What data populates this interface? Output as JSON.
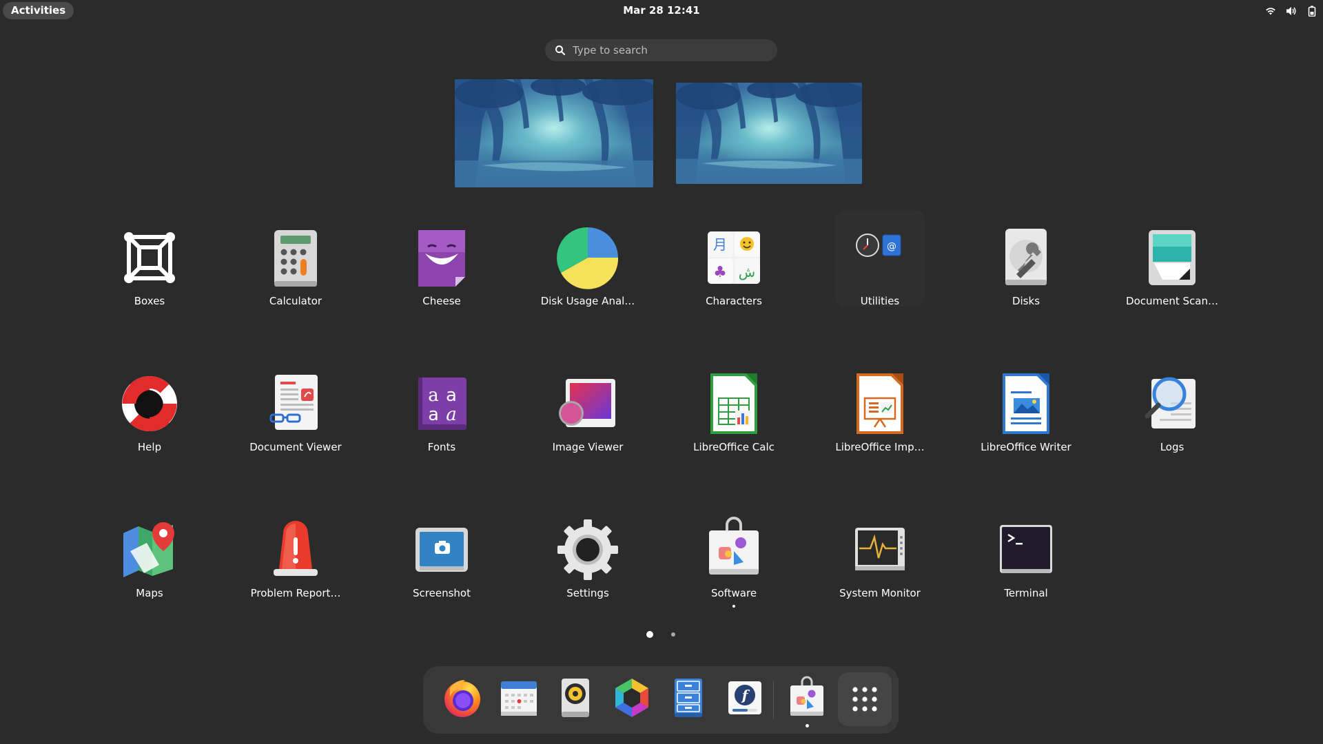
{
  "topbar": {
    "activities_label": "Activities",
    "clock": "Mar 28  12:41",
    "tray_icons": [
      "wifi-icon",
      "volume-icon",
      "battery-icon"
    ]
  },
  "search": {
    "placeholder": "Type to search"
  },
  "workspaces": [
    {
      "name": "workspace-1"
    },
    {
      "name": "workspace-2"
    }
  ],
  "apps": [
    {
      "label": "Boxes"
    },
    {
      "label": "Calculator"
    },
    {
      "label": "Cheese"
    },
    {
      "label": "Disk Usage Anal…"
    },
    {
      "label": "Characters"
    },
    {
      "label": "Utilities"
    },
    {
      "label": "Disks"
    },
    {
      "label": "Document Scan…"
    },
    {
      "label": "Help"
    },
    {
      "label": "Document Viewer"
    },
    {
      "label": "Fonts"
    },
    {
      "label": "Image Viewer"
    },
    {
      "label": "LibreOffice Calc"
    },
    {
      "label": "LibreOffice Imp…"
    },
    {
      "label": "LibreOffice Writer"
    },
    {
      "label": "Logs"
    },
    {
      "label": "Maps"
    },
    {
      "label": "Problem Report…"
    },
    {
      "label": "Screenshot"
    },
    {
      "label": "Settings"
    },
    {
      "label": "Software"
    },
    {
      "label": "System Monitor"
    },
    {
      "label": "Terminal"
    }
  ],
  "pagination": {
    "pages": 2,
    "current": 1
  },
  "dock": {
    "items": [
      "firefox-icon",
      "calendar-icon",
      "rhythmbox-icon",
      "photos-icon",
      "files-icon",
      "fedora-media-writer-icon",
      "software-icon",
      "show-apps-icon"
    ]
  },
  "colors": {
    "background": "#2b2b2b",
    "dock": "#383838",
    "search": "#3c3c3c"
  }
}
